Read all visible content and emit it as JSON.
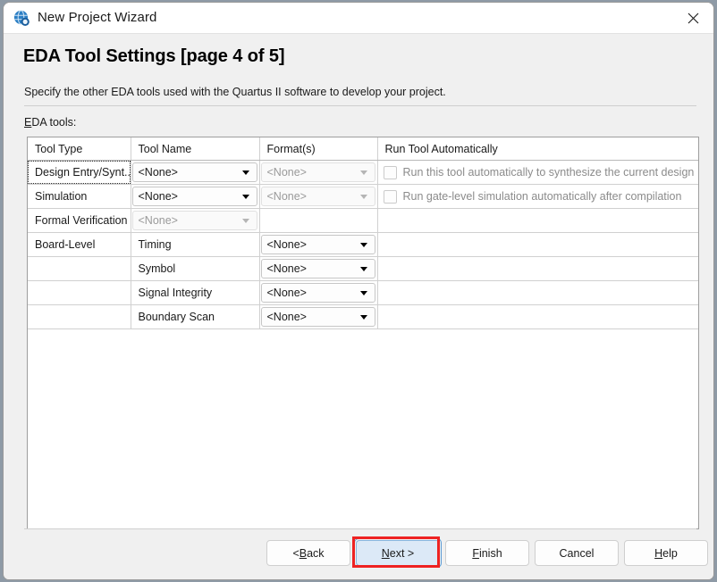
{
  "window": {
    "title": "New Project Wizard",
    "icon": "quartus-globe-icon",
    "close_label": "✕"
  },
  "page": {
    "heading": "EDA Tool Settings [page 4 of 5]",
    "description": "Specify the other EDA tools used with the Quartus II software to develop your project.",
    "list_label_accel": "E",
    "list_label_rest": "DA tools:"
  },
  "table": {
    "columns": [
      "Tool Type",
      "Tool Name",
      "Format(s)",
      "Run Tool Automatically"
    ],
    "rows": [
      {
        "tool_type": "Design Entry/Synt...",
        "tool_type_focused": true,
        "tool_name": "<None>",
        "tool_name_enabled": true,
        "format": "<None>",
        "format_enabled": false,
        "run_label": "Run this tool automatically to synthesize the current design",
        "run_checked": false,
        "run_enabled": false
      },
      {
        "tool_type": "Simulation",
        "tool_type_focused": false,
        "tool_name": "<None>",
        "tool_name_enabled": true,
        "format": "<None>",
        "format_enabled": false,
        "run_label": "Run gate-level simulation automatically after compilation",
        "run_checked": false,
        "run_enabled": false
      },
      {
        "tool_type": "Formal Verification",
        "tool_type_focused": false,
        "tool_name": "<None>",
        "tool_name_enabled": false,
        "format": "",
        "format_enabled": null,
        "run_label": "",
        "run_checked": false,
        "run_enabled": false
      },
      {
        "tool_type": "Board-Level",
        "tool_type_focused": false,
        "tool_name": "Timing",
        "tool_name_enabled": null,
        "format": "<None>",
        "format_enabled": true,
        "run_label": "",
        "run_checked": false,
        "run_enabled": false
      },
      {
        "tool_type": "",
        "tool_type_focused": false,
        "tool_name": "Symbol",
        "tool_name_enabled": null,
        "format": "<None>",
        "format_enabled": true,
        "run_label": "",
        "run_checked": false,
        "run_enabled": false
      },
      {
        "tool_type": "",
        "tool_type_focused": false,
        "tool_name": "Signal Integrity",
        "tool_name_enabled": null,
        "format": "<None>",
        "format_enabled": true,
        "run_label": "",
        "run_checked": false,
        "run_enabled": false
      },
      {
        "tool_type": "",
        "tool_type_focused": false,
        "tool_name": "Boundary Scan",
        "tool_name_enabled": null,
        "format": "<None>",
        "format_enabled": true,
        "run_label": "",
        "run_checked": false,
        "run_enabled": false
      }
    ]
  },
  "buttons": {
    "back": {
      "accel": "B",
      "before": "< ",
      "after": "ack"
    },
    "next": {
      "accel": "N",
      "before": "",
      "after": "ext >"
    },
    "finish": {
      "accel": "F",
      "before": "",
      "after": "inish"
    },
    "cancel": {
      "accel": "",
      "before": "Cancel",
      "after": ""
    },
    "help": {
      "accel": "H",
      "before": "",
      "after": "elp"
    }
  },
  "colors": {
    "accent_focus": "#5d9bd5",
    "highlight_box": "#ee2222",
    "next_button_bg": "#dce9f7",
    "window_bg": "#f0f0f0",
    "panel_bg": "#ffffff"
  }
}
